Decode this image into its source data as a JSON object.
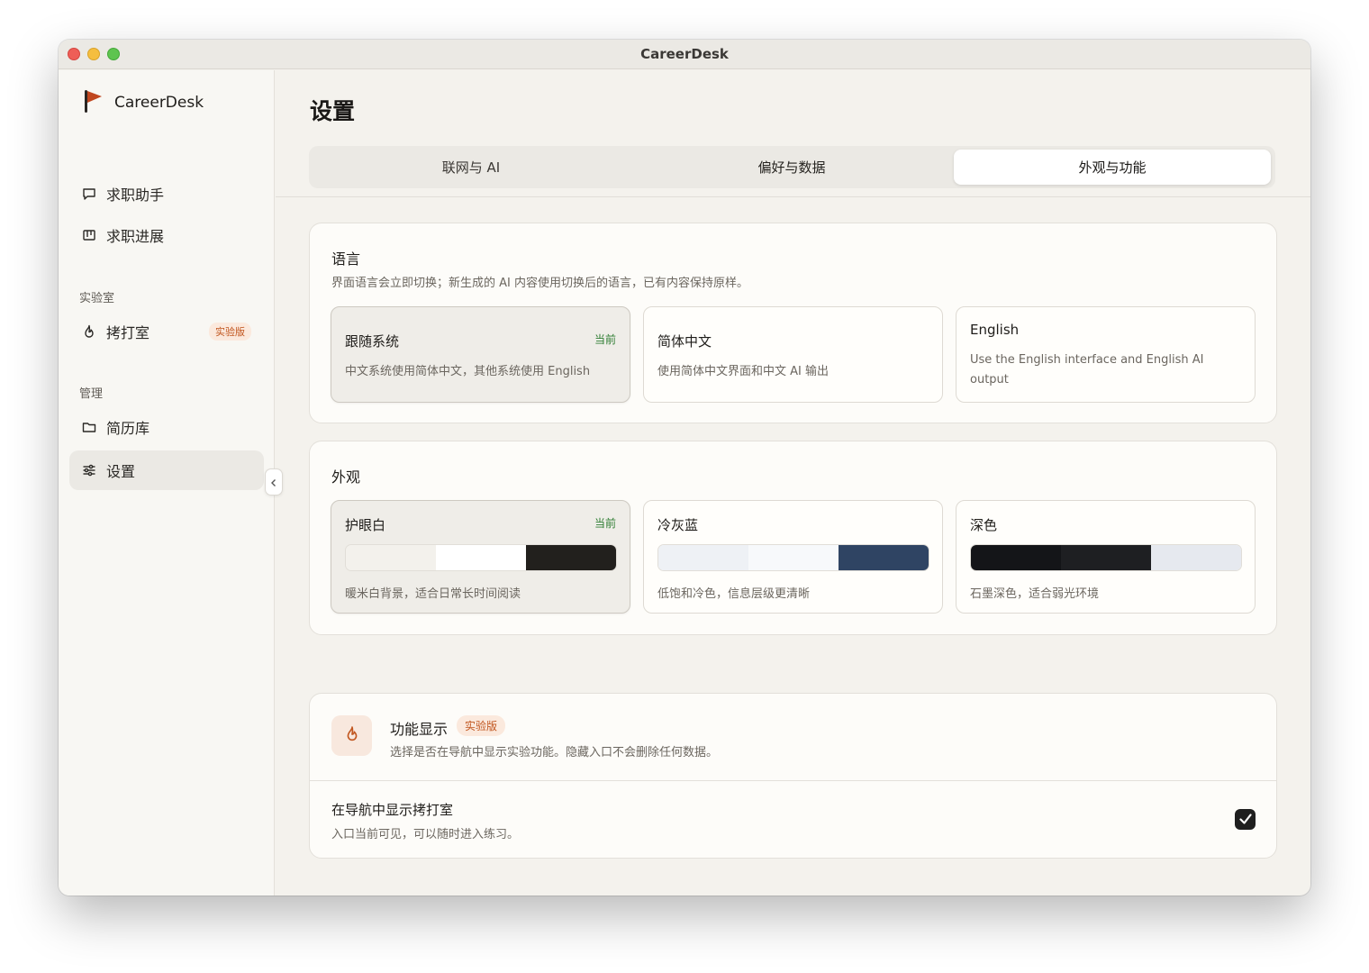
{
  "window": {
    "title": "CareerDesk"
  },
  "sidebar": {
    "brand": "CareerDesk",
    "items": [
      {
        "label": "求职助手",
        "icon": "chat-icon"
      },
      {
        "label": "求职进展",
        "icon": "board-icon"
      }
    ],
    "lab_section": {
      "label": "实验室",
      "item": {
        "label": "拷打室",
        "icon": "flame-icon",
        "badge": "实验版"
      }
    },
    "manage_section": {
      "label": "管理",
      "items": [
        {
          "label": "简历库",
          "icon": "folder-icon"
        },
        {
          "label": "设置",
          "icon": "sliders-icon",
          "active": true
        }
      ]
    }
  },
  "main": {
    "title": "设置",
    "tabs": [
      {
        "label": "联网与 AI"
      },
      {
        "label": "偏好与数据"
      },
      {
        "label": "外观与功能",
        "active": true
      }
    ],
    "language": {
      "title": "语言",
      "desc": "界面语言会立即切换；新生成的 AI 内容使用切换后的语言，已有内容保持原样。",
      "options": [
        {
          "title": "跟随系统",
          "desc": "中文系统使用简体中文，其他系统使用 English",
          "current": "当前"
        },
        {
          "title": "简体中文",
          "desc": "使用简体中文界面和中文 AI 输出"
        },
        {
          "title": "English",
          "desc": "Use the English interface and English AI output"
        }
      ]
    },
    "appearance": {
      "title": "外观",
      "themes": [
        {
          "title": "护眼白",
          "desc": "暖米白背景，适合日常长时间阅读",
          "current": "当前",
          "colors": [
            "#f3f1ec",
            "#ffffff",
            "#22201d"
          ]
        },
        {
          "title": "冷灰蓝",
          "desc": "低饱和冷色，信息层级更清晰",
          "colors": [
            "#eef1f5",
            "#f7f9fb",
            "#2f4463"
          ]
        },
        {
          "title": "深色",
          "desc": "石墨深色，适合弱光环境",
          "colors": [
            "#141518",
            "#1e1f22",
            "#e6e9ef"
          ]
        }
      ]
    },
    "features": {
      "title": "功能显示",
      "badge": "实验版",
      "desc": "选择是否在导航中显示实验功能。隐藏入口不会删除任何数据。",
      "toggle": {
        "title": "在导航中显示拷打室",
        "desc": "入口当前可见，可以随时进入练习。",
        "checked": true
      }
    }
  },
  "colors": {
    "accent": "#c1561f",
    "current_green": "#2e7d32",
    "flag_red": "#c0471f"
  }
}
